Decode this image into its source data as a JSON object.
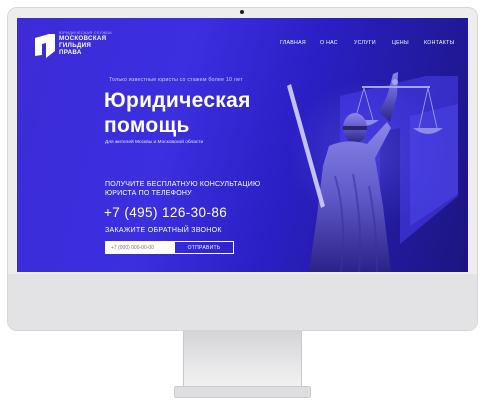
{
  "header": {
    "logo": {
      "subtitle": "ЮРИДИЧЕСКАЯ СЛУЖБА",
      "line1": "МОСКОВСКАЯ",
      "line2": "ГИЛЬДИЯ",
      "line3": "ПРАВА"
    },
    "nav": [
      "ГЛАВНАЯ",
      "О НАС",
      "УСЛУГИ",
      "ЦЕНЫ",
      "КОНТАКТЫ"
    ]
  },
  "hero": {
    "tagline": "Только известные юристы со стажем более 10 лет",
    "title_line1": "Юридическая",
    "title_line2": "помощь",
    "subtitle": "Для жителей Москвы и Московской области",
    "cta_line1": "ПОЛУЧИТЕ БЕСПЛАТНУЮ КОНСУЛЬТАЦИЮ",
    "cta_line2": "ЮРИСТА ПО ТЕЛЕФОНУ",
    "phone": "+7 (495) 126-30-86",
    "callback_label": "ЗАКАЖИТЕ ОБРАТНЫЙ ЗВОНОК",
    "input_placeholder": "+7 (000) 000-00-00",
    "submit_label": "ОТПРАВИТЬ"
  },
  "colors": {
    "accent": "#3b2fe0",
    "text": "#ffffff"
  },
  "icons": [
    "logo-mark-icon",
    "statue-of-justice-image"
  ]
}
